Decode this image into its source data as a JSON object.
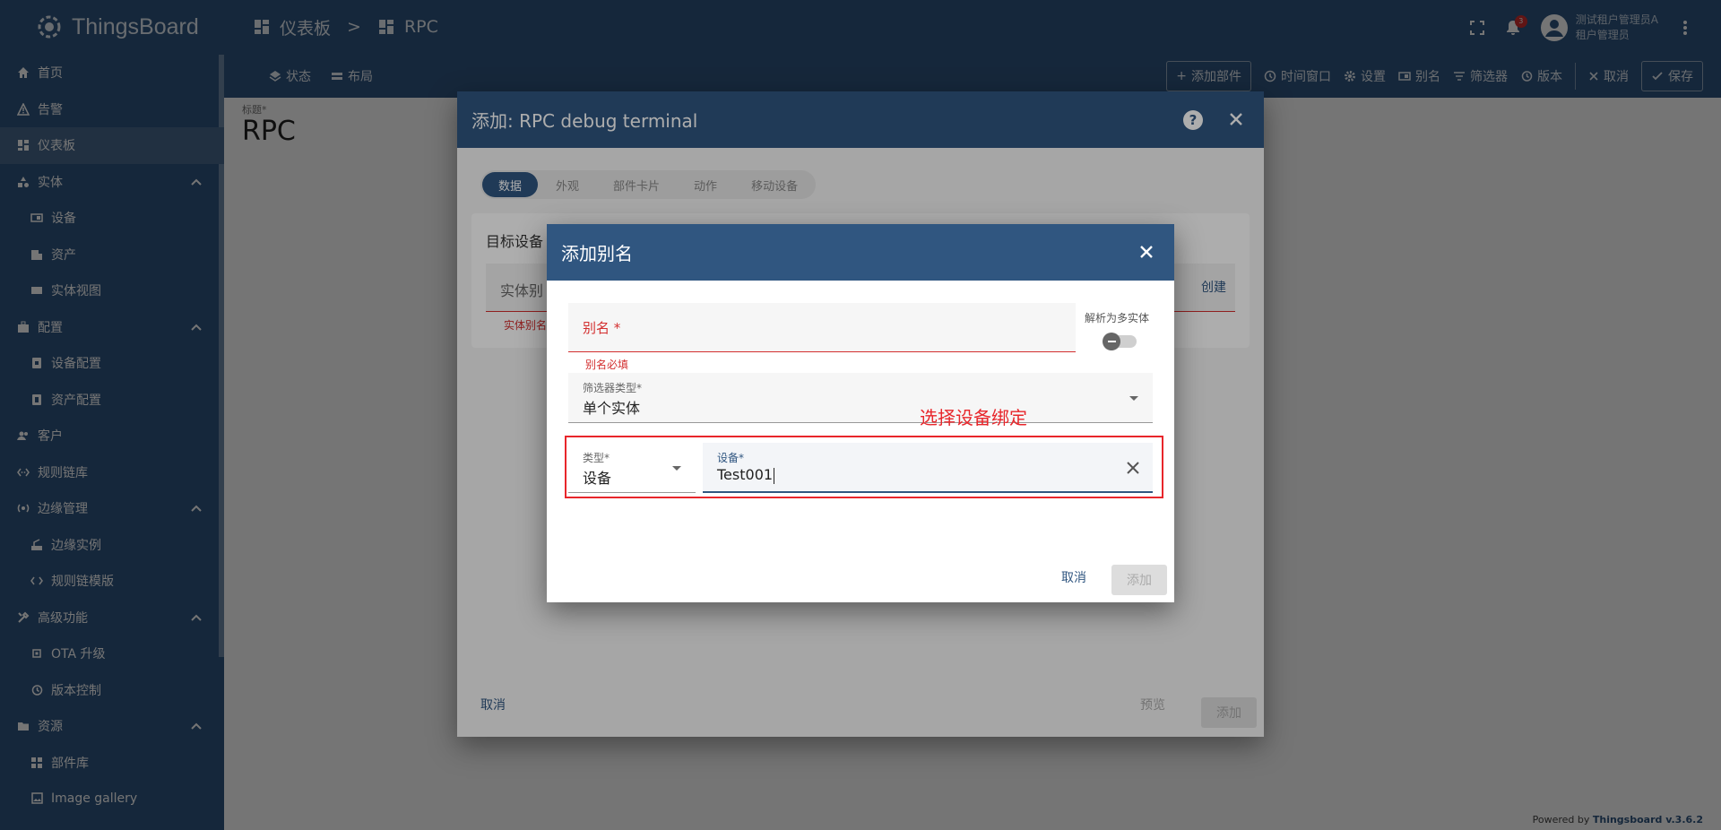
{
  "app": {
    "name": "ThingsBoard"
  },
  "breadcrumb": {
    "dashboards": "仪表板",
    "separator": ">",
    "current": "RPC"
  },
  "header": {
    "notifications_count": "3",
    "user_name": "测试租户管理员A",
    "user_role": "租户管理员"
  },
  "sidebar": {
    "items": [
      {
        "label": "首页",
        "icon": "home-icon"
      },
      {
        "label": "告警",
        "icon": "warning-icon"
      },
      {
        "label": "仪表板",
        "icon": "dashboard-icon"
      },
      {
        "label": "实体",
        "icon": "entity-icon"
      },
      {
        "label": "设备",
        "icon": "device-icon"
      },
      {
        "label": "资产",
        "icon": "asset-icon"
      },
      {
        "label": "实体视图",
        "icon": "entity-view-icon"
      },
      {
        "label": "配置",
        "icon": "profiles-icon"
      },
      {
        "label": "设备配置",
        "icon": "device-profile-icon"
      },
      {
        "label": "资产配置",
        "icon": "asset-profile-icon"
      },
      {
        "label": "客户",
        "icon": "customers-icon"
      },
      {
        "label": "规则链库",
        "icon": "rule-chain-icon"
      },
      {
        "label": "边缘管理",
        "icon": "edge-icon"
      },
      {
        "label": "边缘实例",
        "icon": "edge-instance-icon"
      },
      {
        "label": "规则链模版",
        "icon": "rule-template-icon"
      },
      {
        "label": "高级功能",
        "icon": "advanced-icon"
      },
      {
        "label": "OTA 升级",
        "icon": "ota-icon"
      },
      {
        "label": "版本控制",
        "icon": "version-icon"
      },
      {
        "label": "资源",
        "icon": "folder-icon"
      },
      {
        "label": "部件库",
        "icon": "widgets-icon"
      },
      {
        "label": "Image gallery",
        "icon": "image-icon"
      }
    ]
  },
  "toolbar": {
    "state": "状态",
    "layout": "布局",
    "add_widget": "添加部件",
    "timewindow": "时间窗口",
    "settings": "设置",
    "aliases": "别名",
    "filters": "筛选器",
    "version": "版本",
    "cancel": "取消",
    "save": "保存"
  },
  "page": {
    "title_label": "标题*",
    "title": "RPC",
    "powered_by": "Powered by",
    "powered_link": "Thingsboard v.3.6.2"
  },
  "widget_dialog": {
    "title": "添加: RPC debug terminal",
    "tabs": [
      "数据",
      "外观",
      "部件卡片",
      "动作",
      "移动设备"
    ],
    "target_label": "目标设备",
    "entity_alias_placeholder": "实体别",
    "create": "创建",
    "alias_error": "实体别名",
    "cancel": "取消",
    "preview": "预览",
    "add": "添加"
  },
  "alias_dialog": {
    "title": "添加别名",
    "alias_label": "别名 *",
    "alias_error": "别名必填",
    "resolve_multiple": "解析为多实体",
    "filter_type_label": "筛选器类型*",
    "filter_type_value": "单个实体",
    "annotation": "选择设备绑定",
    "type_label": "类型*",
    "type_value": "设备",
    "device_label": "设备*",
    "device_value": "Test001",
    "cancel": "取消",
    "add": "添加"
  }
}
